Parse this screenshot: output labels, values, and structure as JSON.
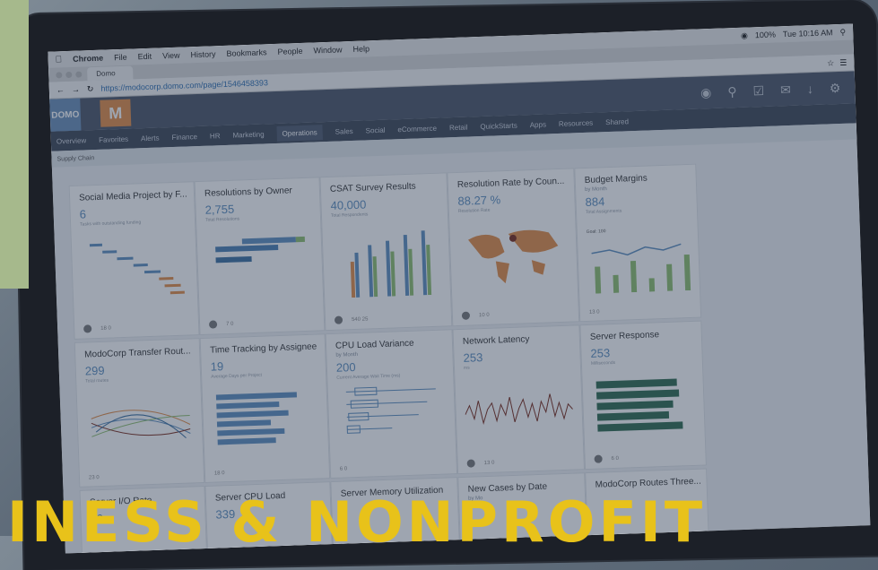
{
  "menubar": {
    "app": "Chrome",
    "items": [
      "File",
      "Edit",
      "View",
      "History",
      "Bookmarks",
      "People",
      "Window",
      "Help"
    ],
    "battery": "100%",
    "clock": "Tue 10:16 AM"
  },
  "browser": {
    "tab_label": "Domo",
    "url": "https://modocorp.domo.com/page/1546458393"
  },
  "domo": {
    "logo": "DOMO",
    "m_logo": "M"
  },
  "nav": {
    "items": [
      "Overview",
      "Favorites",
      "Alerts",
      "Finance",
      "HR",
      "Marketing",
      "Operations",
      "Sales",
      "Social",
      "eCommerce",
      "Retail",
      "QuickStarts",
      "Apps",
      "Resources",
      "Shared"
    ],
    "active": "Operations"
  },
  "subnav": "Supply Chain",
  "cards": [
    {
      "title": "Social Media Project by F...",
      "value": "6",
      "desc": "Tasks with outstanding funding",
      "stats": "18  0"
    },
    {
      "title": "Resolutions by Owner",
      "value": "2,755",
      "desc": "Total Resolutions",
      "stats": "7  0"
    },
    {
      "title": "CSAT Survey Results",
      "value": "40,000",
      "desc": "Total Respondents",
      "stats": "540  25"
    },
    {
      "title": "Resolution Rate by Coun...",
      "value": "88.27 %",
      "desc": "Resolution Rate",
      "stats": "10  0"
    },
    {
      "title": "Budget Margins",
      "sub": "by Month",
      "value": "884",
      "desc": "Total Assignments",
      "goal": "Goal: 100",
      "stats": "13  0"
    },
    {
      "title": "ModoCorp Transfer Rout...",
      "value": "299",
      "desc": "Total routes",
      "stats": "23  0"
    },
    {
      "title": "Time Tracking by Assignee",
      "value": "19",
      "desc": "Average Days per Project",
      "stats": "18  0"
    },
    {
      "title": "CPU Load Variance",
      "sub": "by Month",
      "value": "200",
      "desc": "Current Average Wait Time (ms)",
      "stats": "6  0"
    },
    {
      "title": "Network Latency",
      "value": "253",
      "desc": "ms",
      "stats": "13  0"
    },
    {
      "title": "Server Response",
      "value": "253",
      "desc": "Milliseconds",
      "stats": "6  0"
    },
    {
      "title": "Server I/O Rate",
      "value": "40"
    },
    {
      "title": "Server CPU Load",
      "value": "339"
    },
    {
      "title": "Server Memory Utilization",
      "value": ""
    },
    {
      "title": "New Cases by Date",
      "sub": "by Mo",
      "value": ""
    },
    {
      "title": "ModoCorp Routes Three...",
      "value": ""
    }
  ],
  "banner": "INESS & NONPROFIT",
  "colors": {
    "accent": "#e8c21a",
    "domo_bar": "#4b5566",
    "brand_orange": "#e38d46",
    "green_block": "#a6b98c"
  }
}
